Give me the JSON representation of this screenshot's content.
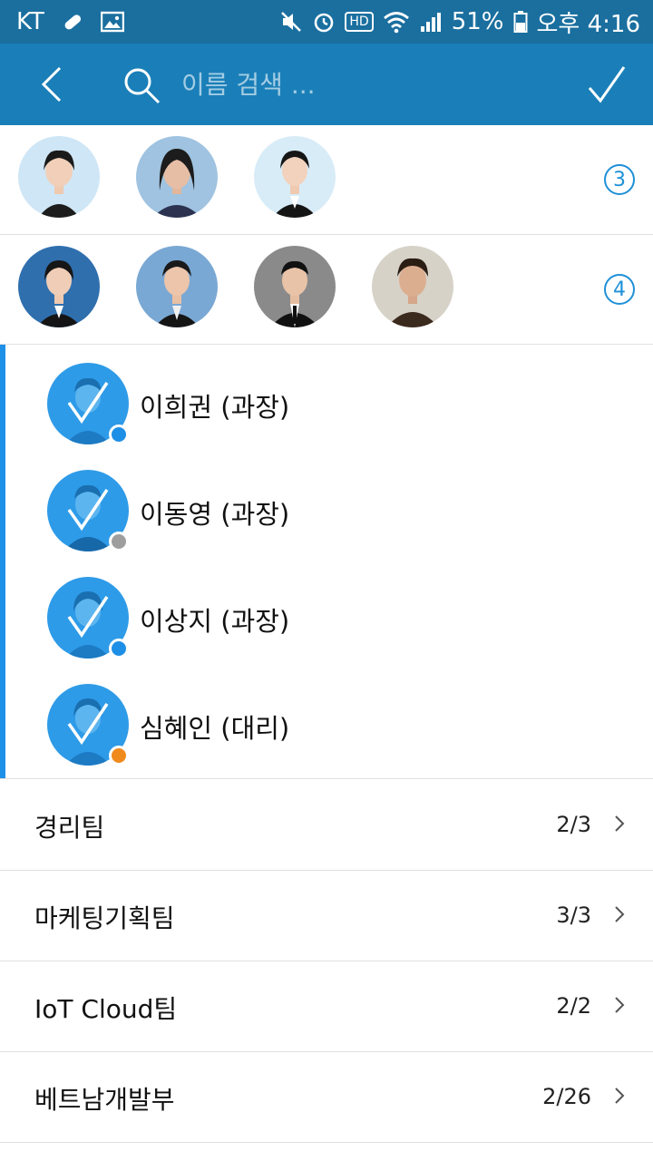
{
  "status_bar": {
    "carrier": "KT",
    "hd_label": "HD",
    "battery": "51%",
    "time": "오후 4:16"
  },
  "search": {
    "placeholder": "이름 검색 ..."
  },
  "groups": [
    {
      "count": "3",
      "avatars": [
        "female-1",
        "female-2",
        "female-3"
      ]
    },
    {
      "count": "4",
      "avatars": [
        "female-4",
        "female-5",
        "male-1",
        "male-2"
      ]
    }
  ],
  "selected_members": [
    {
      "name": "이희권 (과장)",
      "status_color": "#1e8fe6",
      "status": "online"
    },
    {
      "name": "이동영 (과장)",
      "status_color": "#9e9e9e",
      "status": "away"
    },
    {
      "name": "이상지 (과장)",
      "status_color": "#1e8fe6",
      "status": "online"
    },
    {
      "name": "심혜인 (대리)",
      "status_color": "#f08a1c",
      "status": "mobile"
    }
  ],
  "teams": [
    {
      "name": "경리팀",
      "count": "2/3"
    },
    {
      "name": "마케팅기획팀",
      "count": "3/3"
    },
    {
      "name": "IoT Cloud팀",
      "count": "2/2"
    },
    {
      "name": "베트남개발부",
      "count": "2/26"
    }
  ],
  "colors": {
    "status_bar": "#1a6f9f",
    "app_bar": "#1a7fb8",
    "accent": "#1e90e8"
  }
}
